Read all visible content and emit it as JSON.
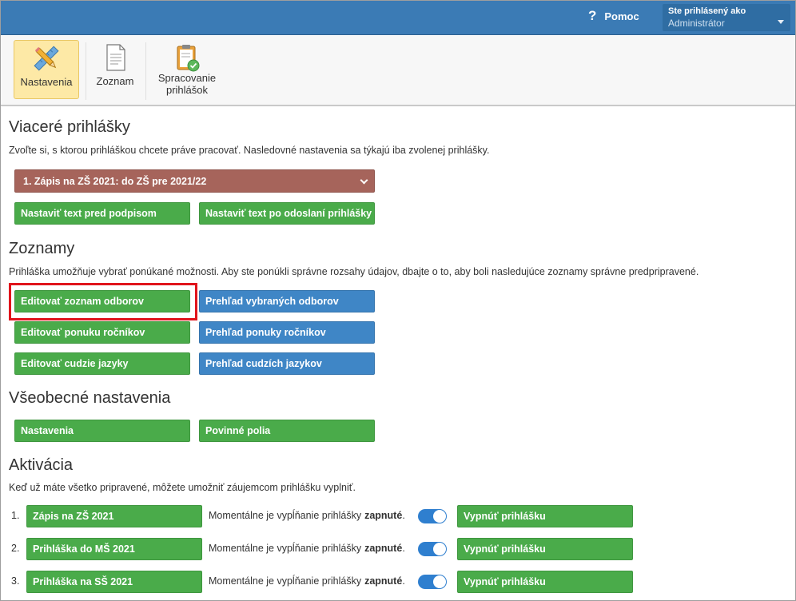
{
  "topbar": {
    "help_label": "Pomoc",
    "user_label": "Ste prihlásený ako",
    "user_name": "Administrátor"
  },
  "ribbon": {
    "settings_label": "Nastavenia",
    "list_label": "Zoznam",
    "processing_label_1": "Spracovanie",
    "processing_label_2": "prihlášok"
  },
  "multi": {
    "title": "Viaceré prihlášky",
    "desc": "Zvoľte si, s ktorou prihláškou chcete práve pracovať. Nasledovné nastavenia sa týkajú iba zvolenej prihlášky.",
    "selected": "1. Zápis na ZŠ 2021: do ZŠ pre 2021/22",
    "btn_before_sign": "Nastaviť text pred podpisom",
    "btn_after_send": "Nastaviť text po odoslaní prihlášky"
  },
  "lists": {
    "title": "Zoznamy",
    "desc": "Prihláška umožňuje vybrať ponúkané možnosti. Aby ste ponúkli správne rozsahy údajov, dbajte o to, aby boli nasledujúce zoznamy správne predpripravené.",
    "edit_fields": "Editovať zoznam odborov",
    "view_fields": "Prehľad vybraných odborov",
    "edit_years": "Editovať ponuku ročníkov",
    "view_years": "Prehľad ponuky ročníkov",
    "edit_langs": "Editovať cudzie jazyky",
    "view_langs": "Prehľad cudzích jazykov"
  },
  "general": {
    "title": "Všeobecné nastavenia",
    "settings": "Nastavenia",
    "required": "Povinné polia"
  },
  "activation": {
    "title": "Aktivácia",
    "desc": "Keď už máte všetko pripravené, môžete umožniť záujemcom prihlášku vyplniť.",
    "status_prefix": "Momentálne je vypĺňanie prihlášky",
    "status_value": "zapnuté",
    "status_suffix": ".",
    "disable_label": "Vypnúť prihlášku",
    "rows": [
      {
        "num": "1.",
        "name": "Zápis na ZŠ 2021"
      },
      {
        "num": "2.",
        "name": "Prihláška do MŠ 2021"
      },
      {
        "num": "3.",
        "name": "Prihláška na SŠ 2021"
      }
    ]
  },
  "colors": {
    "topbar": "#3b7bb5",
    "green": "#4aab4a",
    "blue": "#3f86c6",
    "select": "#a6645b",
    "highlight": "#e0141c"
  }
}
